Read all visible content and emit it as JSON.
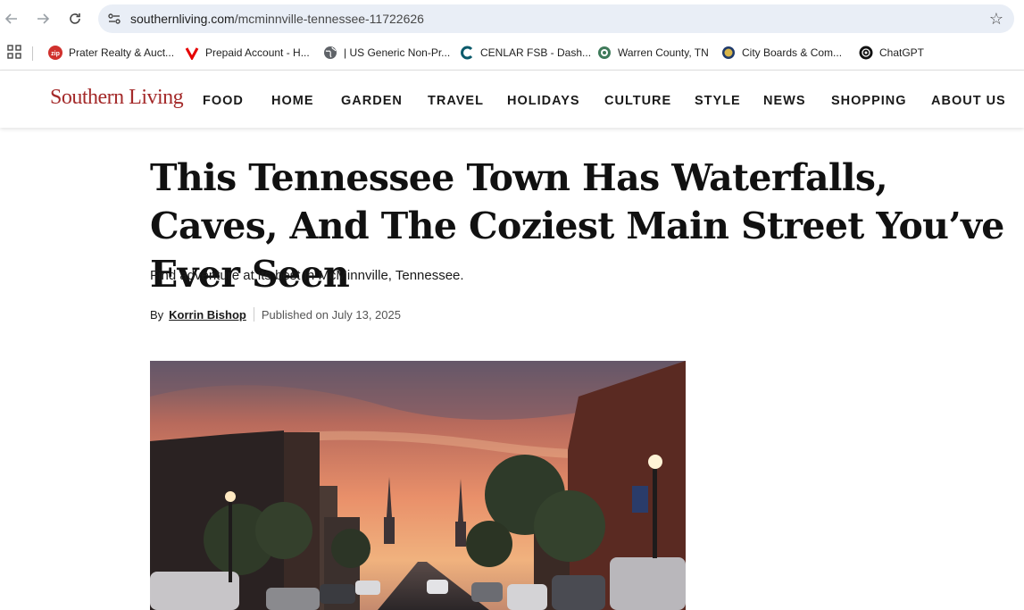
{
  "browser": {
    "url_domain": "southernliving.com",
    "url_path": "/mcminnville-tennessee-11722626",
    "bookmarks": [
      {
        "label": "Prater Realty & Auct...",
        "icon": "zip-icon",
        "color": "#d0312d"
      },
      {
        "label": "Prepaid Account - H...",
        "icon": "verizon-icon",
        "color": "#e60000"
      },
      {
        "label": "| US Generic Non-Pr...",
        "icon": "globe-icon",
        "color": "#5f6368"
      },
      {
        "label": "CENLAR FSB - Dash...",
        "icon": "cenlar-icon",
        "color": "#0b5a6b"
      },
      {
        "label": "Warren County, TN",
        "icon": "county-seal-icon",
        "color": "#3f7a5a"
      },
      {
        "label": "City Boards & Com...",
        "icon": "city-seal-icon",
        "color": "#8a6d1e"
      },
      {
        "label": "ChatGPT",
        "icon": "chatgpt-icon",
        "color": "#111111"
      }
    ]
  },
  "site": {
    "logo": "Southern Living",
    "nav": [
      "FOOD",
      "HOME",
      "GARDEN",
      "TRAVEL",
      "HOLIDAYS",
      "CULTURE",
      "STYLE",
      "NEWS",
      "SHOPPING",
      "ABOUT US"
    ]
  },
  "article": {
    "headline": "This Tennessee Town Has Waterfalls, Caves, And The Coziest Main Street You’ve Ever Seen",
    "dek": "Find adventure at its best in McMinnville, Tennessee.",
    "by_label": "By",
    "author": "Korrin Bishop",
    "published": "Published on July 13, 2025"
  },
  "colors": {
    "brand": "#a42a2a",
    "omnibox_bg": "#e9eef6"
  }
}
